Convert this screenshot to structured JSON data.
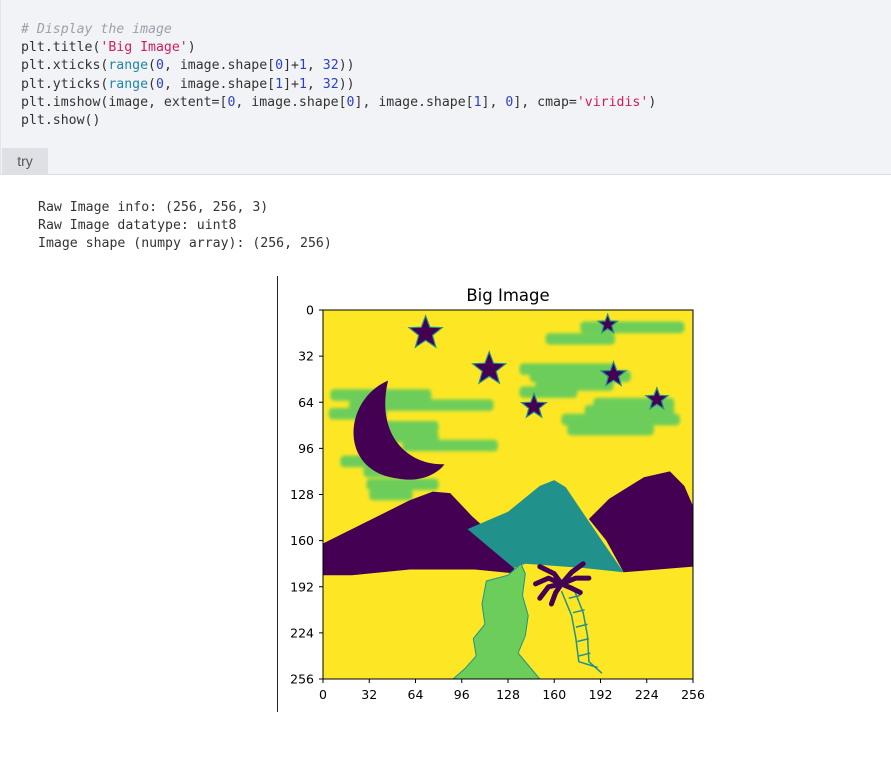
{
  "code": {
    "lines": [
      [
        {
          "t": "# Display the image",
          "c": "com"
        }
      ],
      [
        {
          "t": "plt.title(",
          "c": "plain"
        },
        {
          "t": "'Big Image'",
          "c": "str"
        },
        {
          "t": ")",
          "c": "plain"
        }
      ],
      [
        {
          "t": "plt.xticks(",
          "c": "plain"
        },
        {
          "t": "range",
          "c": "fn"
        },
        {
          "t": "(",
          "c": "plain"
        },
        {
          "t": "0",
          "c": "num"
        },
        {
          "t": ", image.shape[",
          "c": "plain"
        },
        {
          "t": "0",
          "c": "num"
        },
        {
          "t": "]+",
          "c": "plain"
        },
        {
          "t": "1",
          "c": "num"
        },
        {
          "t": ", ",
          "c": "plain"
        },
        {
          "t": "32",
          "c": "num"
        },
        {
          "t": "))",
          "c": "plain"
        }
      ],
      [
        {
          "t": "plt.yticks(",
          "c": "plain"
        },
        {
          "t": "range",
          "c": "fn"
        },
        {
          "t": "(",
          "c": "plain"
        },
        {
          "t": "0",
          "c": "num"
        },
        {
          "t": ", image.shape[",
          "c": "plain"
        },
        {
          "t": "1",
          "c": "num"
        },
        {
          "t": "]+",
          "c": "plain"
        },
        {
          "t": "1",
          "c": "num"
        },
        {
          "t": ", ",
          "c": "plain"
        },
        {
          "t": "32",
          "c": "num"
        },
        {
          "t": "))",
          "c": "plain"
        }
      ],
      [
        {
          "t": "plt.imshow(image, extent=[",
          "c": "plain"
        },
        {
          "t": "0",
          "c": "num"
        },
        {
          "t": ", image.shape[",
          "c": "plain"
        },
        {
          "t": "0",
          "c": "num"
        },
        {
          "t": "], image.shape[",
          "c": "plain"
        },
        {
          "t": "1",
          "c": "num"
        },
        {
          "t": "], ",
          "c": "plain"
        },
        {
          "t": "0",
          "c": "num"
        },
        {
          "t": "], cmap=",
          "c": "plain"
        },
        {
          "t": "'viridis'",
          "c": "str"
        },
        {
          "t": ")",
          "c": "plain"
        }
      ],
      [
        {
          "t": "plt.show()",
          "c": "plain"
        }
      ]
    ]
  },
  "try_button": {
    "label": "try"
  },
  "output": {
    "lines": [
      "Raw Image info: (256, 256, 3)",
      "Raw Image datatype: uint8",
      "Image shape (numpy array): (256, 256)"
    ]
  },
  "plot": {
    "title": "Big Image",
    "x_ticks": [
      "0",
      "32",
      "64",
      "96",
      "128",
      "160",
      "192",
      "224",
      "256"
    ],
    "y_ticks": [
      "0",
      "32",
      "64",
      "96",
      "128",
      "160",
      "192",
      "224",
      "256"
    ],
    "extent": [
      0,
      256,
      256,
      0
    ],
    "colors": {
      "background": "#fde725",
      "dark": "#440154",
      "teal": "#21918c",
      "green": "#6ccd5a"
    }
  }
}
